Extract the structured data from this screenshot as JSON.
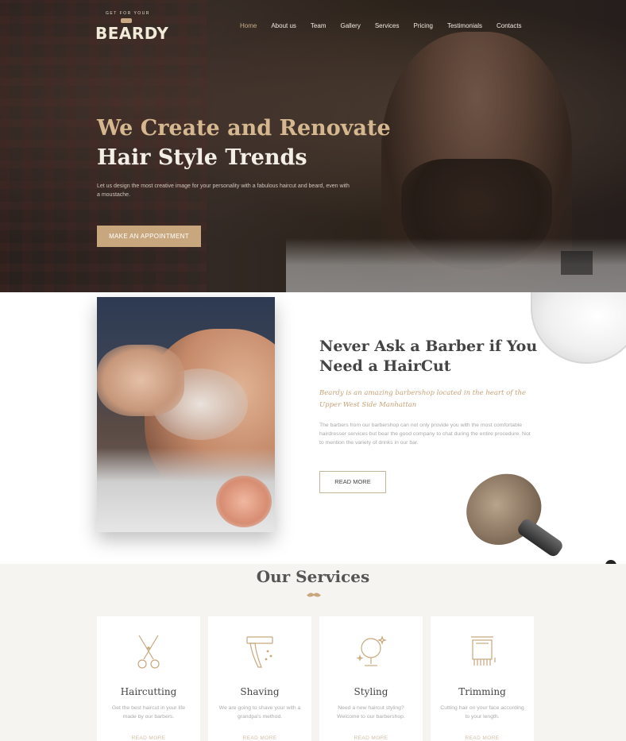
{
  "brand": {
    "tagline": "GET FOR YOUR",
    "name": "BEARDY"
  },
  "nav": {
    "items": [
      {
        "label": "Home",
        "active": true
      },
      {
        "label": "About us"
      },
      {
        "label": "Team"
      },
      {
        "label": "Gallery"
      },
      {
        "label": "Services"
      },
      {
        "label": "Pricing"
      },
      {
        "label": "Testimonials"
      },
      {
        "label": "Contacts"
      }
    ]
  },
  "hero": {
    "title_line1": "We Create and Renovate",
    "title_line2": "Hair Style Trends",
    "subtitle": "Let us design the most creative image for your personality with a fabulous haircut and beard, even with a moustache.",
    "cta_label": "MAKE AN APPOINTMENT"
  },
  "about": {
    "heading": "Never Ask a Barber if You Need a HairCut",
    "lead": "Beardy is an amazing barbershop located in the heart of the Upper West Side Manhattan",
    "body": "The barbers from our barbershop can not only provide you with the most comfortable hairdresser services but bear the good company to chat during the entire procedure. Not to mention the variety of drinks in our bar.",
    "button_label": "READ MORE"
  },
  "services": {
    "title": "Our Services",
    "cards": [
      {
        "title": "Haircutting",
        "icon": "scissors-icon",
        "desc": "Get the best haircut in your life made by our barbers.",
        "more": "READ MORE"
      },
      {
        "title": "Shaving",
        "icon": "razor-icon",
        "desc": "We are going to shave your with a grandpa's method.",
        "more": "READ MORE"
      },
      {
        "title": "Styling",
        "icon": "mirror-icon",
        "desc": "Need a new haircut styling? Welcome to our barbershop.",
        "more": "READ MORE"
      },
      {
        "title": "Trimming",
        "icon": "trimmer-icon",
        "desc": "Cutting hair on your face according to your length.",
        "more": "READ MORE"
      }
    ]
  },
  "colors": {
    "accent": "#c9a77e",
    "text": "#444444",
    "muted": "#aaaaaa",
    "background": "#f6f4f1"
  }
}
